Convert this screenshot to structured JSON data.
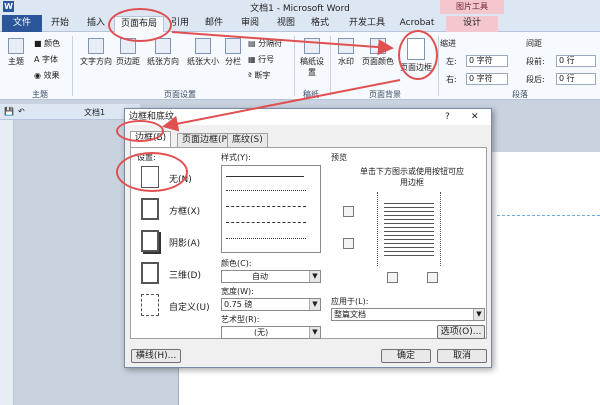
{
  "window": {
    "title": "文档1 - Microsoft Word",
    "context_tab": "图片工具"
  },
  "tabs": {
    "file": "文件",
    "home": "开始",
    "insert": "插入",
    "layout": "页面布局",
    "ref": "引用",
    "mail": "邮件",
    "review": "审阅",
    "view": "视图",
    "format": "格式",
    "dev": "开发工具",
    "acrobat": "Acrobat",
    "design": "设计"
  },
  "ribbon": {
    "themes": "主题",
    "colors": "颜色",
    "fonts": "字体",
    "effects": "效果",
    "textdir": "文字方向",
    "margins": "页边距",
    "orient": "纸张方向",
    "size": "纸张大小",
    "cols": "分栏",
    "breaks": "分隔符",
    "linenum": "行号",
    "hyph": "断字",
    "drafts": "稿纸设置",
    "watermark": "水印",
    "pagecolor": "页面颜色",
    "pageborder": "页面边框",
    "indent": "缩进",
    "left_lbl": "左:",
    "right_lbl": "右:",
    "left_val": "0 字符",
    "right_val": "0 字符",
    "spacing": "间距",
    "before_lbl": "段前:",
    "after_lbl": "段后:",
    "before_val": "0 行",
    "after_val": "0 行",
    "g_theme": "主题",
    "g_page": "页面设置",
    "g_drafts": "稿纸",
    "g_bg": "页面背景",
    "g_para": "段落"
  },
  "docbar": {
    "name": "文档1"
  },
  "dialog": {
    "title": "边框和底纹",
    "help": "?",
    "close": "✕",
    "tabs": {
      "border": "边框(B)",
      "page_border": "页面边框(P)",
      "shading": "底纹(S)"
    },
    "settings_label": "设置:",
    "settings": {
      "none": "无(N)",
      "box": "方框(X)",
      "shadow": "阴影(A)",
      "threed": "三维(D)",
      "custom": "自定义(U)"
    },
    "style_label": "样式(Y):",
    "color_label": "颜色(C):",
    "color_val": "自动",
    "width_label": "宽度(W):",
    "width_val": "0.75 磅",
    "art_label": "艺术型(R):",
    "art_val": "(无)",
    "preview_label": "预览",
    "preview_hint": "单击下方图示或使用按钮可应用边框",
    "apply_label": "应用于(L):",
    "apply_val": "整篇文档",
    "options": "选项(O)...",
    "hline": "横线(H)...",
    "ok": "确定",
    "cancel": "取消"
  }
}
